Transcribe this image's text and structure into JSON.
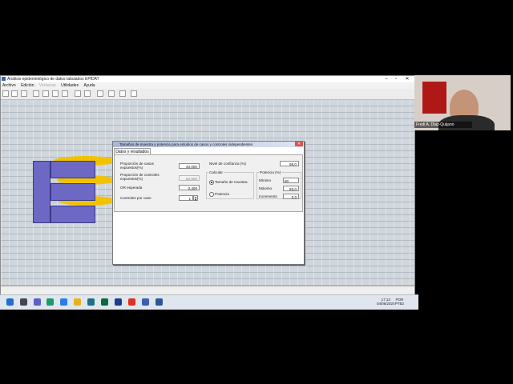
{
  "window": {
    "title": "Análisis epidemiológico de datos tabulados EPIDAT",
    "controls": [
      "–",
      "▫",
      "✕"
    ]
  },
  "menu": [
    {
      "label": "Archivo",
      "enabled": true
    },
    {
      "label": "Edición",
      "enabled": true
    },
    {
      "label": "Ventanas",
      "enabled": false
    },
    {
      "label": "Utilidades",
      "enabled": true
    },
    {
      "label": "Ayuda",
      "enabled": true
    }
  ],
  "dialog": {
    "title": "Tamaños de muestra y potencia para estudios de casos y controles independientes",
    "close": "✕",
    "tab": "Datos y resultados",
    "fields": {
      "prop_casos_label": "Proporción de casos expuestos(%)",
      "prop_casos_value": "40,000",
      "prop_controles_label": "Proporción de controles expuestos(%)",
      "prop_controles_value": "62,500",
      "or_label": "OR esperada",
      "or_value": "0,400",
      "controles_label": "Controles por caso",
      "controles_value": "1",
      "nivel_label": "Nivel de confianza (%)",
      "nivel_value": "95,0"
    },
    "calcular": {
      "title": "Calcular",
      "option1": "Tamaño de muestra",
      "option2": "Potencia",
      "selected": "option1"
    },
    "potencia": {
      "title": "Potencia (%)",
      "minimo_label": "Mínimo",
      "minimo_value": "80",
      "maximo_label": "Máximo",
      "maximo_value": "80,0",
      "incremento_label": "Incremento",
      "incremento_value": "0,0"
    }
  },
  "webcam": {
    "name_tag": "Fredi A. Diaz-Quijano"
  },
  "tray": {
    "lang1": "POR",
    "lang2": "PTB2",
    "time": "17:13",
    "date": "04/06/2024"
  },
  "colors": {
    "accent": "#3a5fb0",
    "logo_blue": "#6c68c4",
    "logo_yellow": "#f2c200"
  }
}
